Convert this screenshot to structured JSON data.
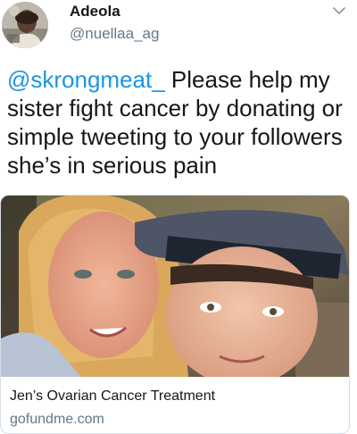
{
  "tweet": {
    "author": {
      "display_name": "Adeola",
      "handle": "@nuellaa_ag",
      "avatar_icon": "user-avatar"
    },
    "menu_icon": "chevron-down-icon",
    "text": {
      "mention": "@skrongmeat_",
      "body": " Please help my sister fight cancer by donating or simple tweeting to your followers she’s in serious pain"
    },
    "card": {
      "title": "Jen’s Ovarian Cancer Treatment",
      "domain": "gofundme.com"
    },
    "colors": {
      "mention": "#1b95e0",
      "secondary_text": "#657786",
      "primary_text": "#14171a",
      "border": "#d6dde3"
    }
  }
}
